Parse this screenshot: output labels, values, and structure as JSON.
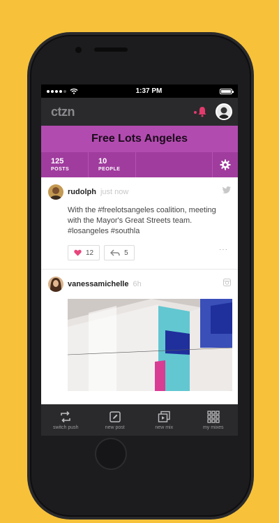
{
  "status_bar": {
    "time": "1:37 PM"
  },
  "app": {
    "logo": "ctzn"
  },
  "group": {
    "title": "Free Lots Angeles",
    "stats": [
      {
        "value": "125",
        "label": "POSTS"
      },
      {
        "value": "10",
        "label": "PEOPLE"
      }
    ]
  },
  "posts": [
    {
      "username": "rudolph",
      "time": "just now",
      "source_icon": "twitter-icon",
      "text": "With the #freelotsangeles coalition, meeting with the Mayor's Great Streets team. #losangeles #southla",
      "likes": "12",
      "shares": "5",
      "more": "···"
    },
    {
      "username": "vanessamichelle",
      "time": "6h",
      "source_icon": "instagram-icon"
    }
  ],
  "tabbar": [
    {
      "label": "switch push",
      "icon": "switch-icon"
    },
    {
      "label": "new post",
      "icon": "pencil-icon"
    },
    {
      "label": "new mix",
      "icon": "stack-icon"
    },
    {
      "label": "my mixes",
      "icon": "grid-icon"
    }
  ],
  "colors": {
    "background": "#f7c23a",
    "banner": "#b24bb0",
    "stats_bar": "#a03c9e",
    "app_bar": "#2a2a2c",
    "like_heart": "#e8467c"
  }
}
